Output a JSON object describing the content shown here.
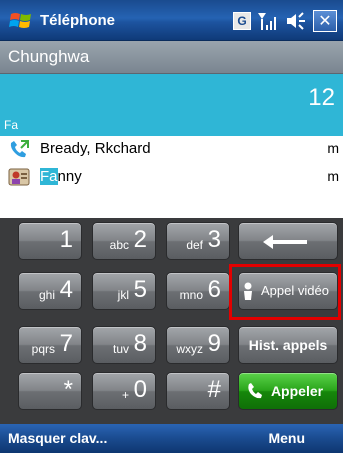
{
  "titlebar": {
    "title": "Téléphone",
    "g_icon": "G",
    "close": "✕",
    "icons": [
      "windows-flag-icon",
      "g-icon",
      "signal-icon",
      "volume-icon",
      "close-icon"
    ]
  },
  "carrier": "Chunghwa",
  "dial": {
    "number": "12",
    "matched": "Fa"
  },
  "results": [
    {
      "name": "Bready, Rkchard",
      "type": "m",
      "icon": "call-history-icon"
    },
    {
      "name_highlight": "Fa",
      "name_rest": "nny",
      "type": "m",
      "icon": "contact-card-icon"
    }
  ],
  "keypad": {
    "keys": [
      {
        "digit": "1",
        "letters": ""
      },
      {
        "digit": "2",
        "letters": "abc"
      },
      {
        "digit": "3",
        "letters": "def"
      },
      {
        "digit": "4",
        "letters": "ghi"
      },
      {
        "digit": "5",
        "letters": "jkl"
      },
      {
        "digit": "6",
        "letters": "mno"
      },
      {
        "digit": "7",
        "letters": "pqrs"
      },
      {
        "digit": "8",
        "letters": "tuv"
      },
      {
        "digit": "9",
        "letters": "wxyz"
      },
      {
        "digit": "*",
        "letters": ""
      },
      {
        "digit": "0",
        "letters": "+"
      },
      {
        "digit": "#",
        "letters": ""
      }
    ],
    "video_call": "Appel vidéo",
    "history": "Hist. appels",
    "call": "Appeler"
  },
  "softkeys": {
    "left": "Masquer clav...",
    "right": "Menu"
  },
  "colors": {
    "accent": "#2fb6d6",
    "highlight_box": "#e30000",
    "call_green": "#2aa51b"
  }
}
